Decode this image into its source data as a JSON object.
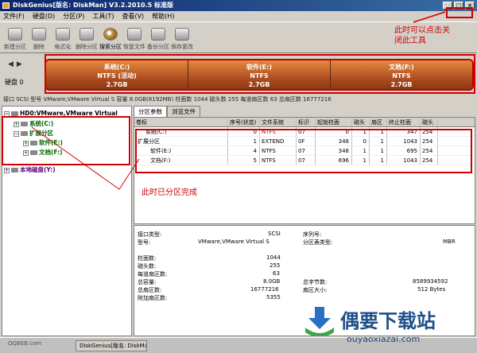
{
  "window": {
    "title": "DiskGenius[版名: DiskMan] V3.2.2010.5 标准版"
  },
  "menu": [
    "文件(F)",
    "硬盘(D)",
    "分区(P)",
    "工具(T)",
    "查看(V)",
    "帮助(H)"
  ],
  "toolbar": [
    "新建分区",
    "删除",
    "格式化",
    "删除分区",
    "搜索分区",
    "恢复文件",
    "备份分区",
    "保存更改"
  ],
  "disk": {
    "label": "硬盘 0",
    "partitions": [
      {
        "name": "系统(C:)",
        "fs": "NTFS (活动)",
        "size": "2.7GB"
      },
      {
        "name": "软件(E:)",
        "fs": "NTFS",
        "size": "2.7GB"
      },
      {
        "name": "文档(F:)",
        "fs": "NTFS",
        "size": "2.7GB"
      }
    ],
    "info": "接口 SCSI  型号 VMware,VMware Virtual S  容量 8.0GB(8192MB)  柱面数 1044  磁头数 255  每道扇区数 63  总扇区数 16777216"
  },
  "tree": {
    "root": "HD0:VMware,VMware Virtual",
    "items": [
      "系统(C:)",
      "扩展分区",
      "软件(E:)",
      "文档(F:)"
    ],
    "local": "本地磁盘(Y:)"
  },
  "tabs": [
    "分区参数",
    "浏览文件"
  ],
  "table": {
    "headers": [
      "卷标",
      "序号(状态)",
      "文件系统",
      "标识",
      "起始柱面",
      "磁头",
      "扇区",
      "终止柱面",
      "磁头"
    ],
    "rows": [
      [
        "系统(C:)",
        "0",
        "NTFS",
        "07",
        "0",
        "1",
        "1",
        "347",
        "254"
      ],
      [
        "扩展分区",
        "1",
        "EXTEND",
        "0F",
        "348",
        "0",
        "1",
        "1043",
        "254"
      ],
      [
        "软件(E:)",
        "4",
        "NTFS",
        "07",
        "348",
        "1",
        "1",
        "695",
        "254"
      ],
      [
        "文档(F:)",
        "5",
        "NTFS",
        "07",
        "696",
        "1",
        "1",
        "1043",
        "254"
      ]
    ]
  },
  "details": {
    "iface_label": "接口类型:",
    "iface_val": "SCSI",
    "model_label": "型号:",
    "model_val": "VMware,VMware Virtual S",
    "serial_label": "序列号:",
    "ptype_label": "分区表类型:",
    "ptype_val": "MBR",
    "cyl_label": "柱面数:",
    "cyl_val": "1044",
    "heads_label": "磁头数:",
    "heads_val": "255",
    "spt_label": "每道扇区数:",
    "spt_val": "63",
    "cap_label": "总容量:",
    "cap_val": "8.0GB",
    "ts_label": "总扇区数:",
    "ts_val": "16777216",
    "extra_label": "附加扇区数:",
    "extra_val": "5355",
    "bytes_label": "总字节数:",
    "bytes_val": "8589934592",
    "sector_label": "扇区大小:",
    "sector_val": "512 Bytes"
  },
  "taskbar": {
    "button": "DiskGenius[版名: DiskMan]"
  },
  "annotations": {
    "close": "此时可以点击关\n闭此工具",
    "done": "此时已分区完成"
  },
  "watermark": {
    "text": "偶要下载站",
    "url": "ouyaoxiazai.com",
    "qbrand": "QQBEB.com"
  },
  "colors": {
    "accent": "#d00000",
    "partition": "#c0602a",
    "fs": "#006400"
  }
}
